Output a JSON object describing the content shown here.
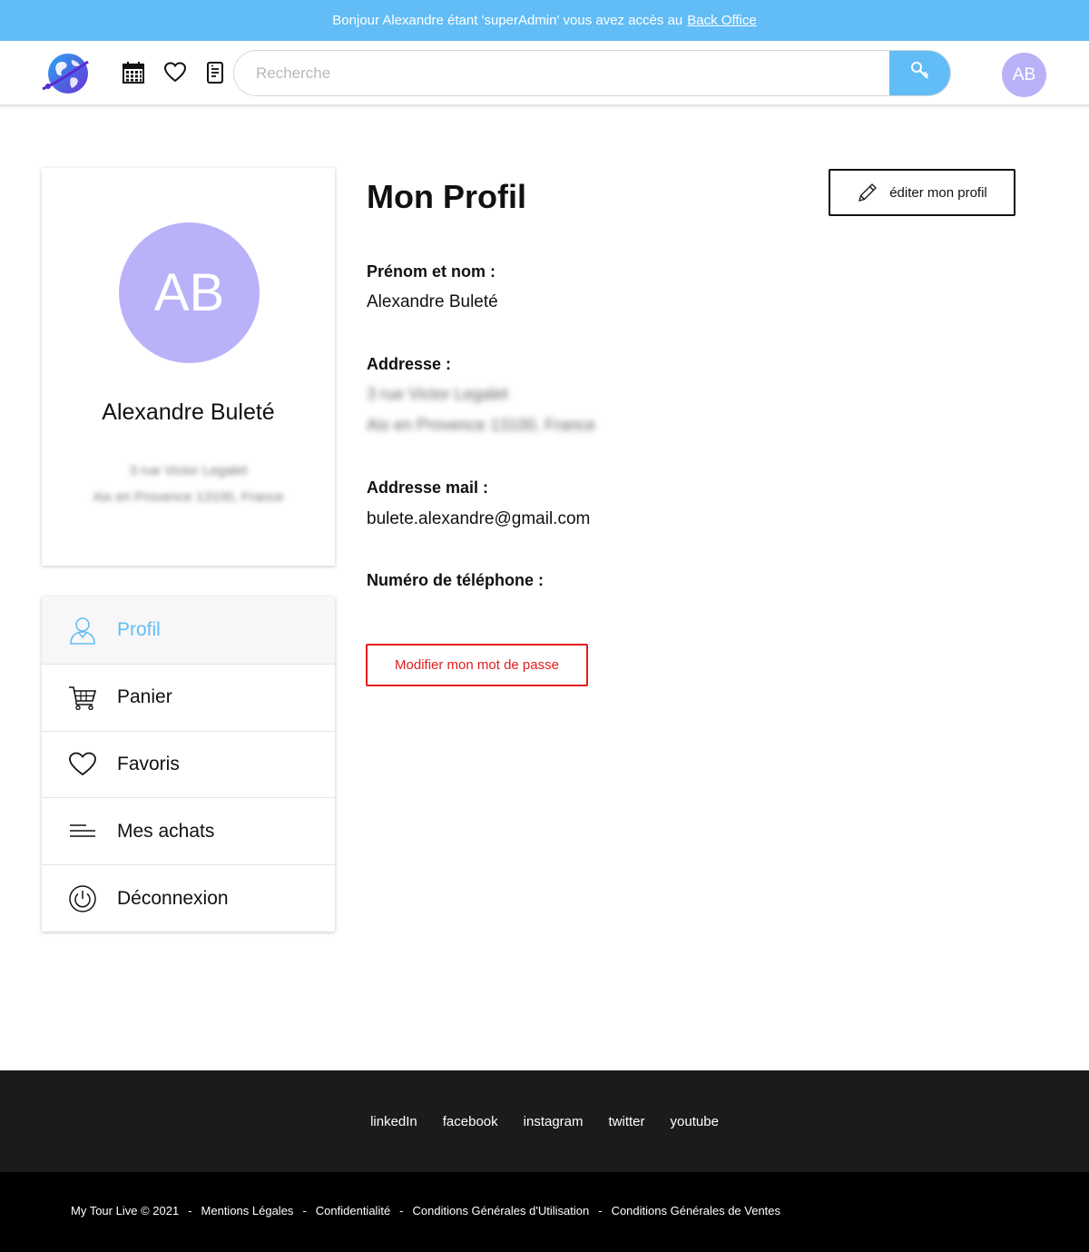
{
  "banner": {
    "text": "Bonjour Alexandre étant 'superAdmin' vous avez accès au",
    "link": "Back Office"
  },
  "header": {
    "search_placeholder": "Recherche",
    "avatar_initials": "AB",
    "icons": [
      "globe-logo-icon",
      "calendar-icon",
      "heart-icon",
      "document-icon",
      "key-icon"
    ]
  },
  "profile_card": {
    "initials": "AB",
    "name": "Alexandre Buleté",
    "address_line1": "3 rue Victor Legalet",
    "address_line2": "Aix en Provence 13100, France"
  },
  "menu": {
    "items": [
      {
        "label": "Profil",
        "icon": "user-icon"
      },
      {
        "label": "Panier",
        "icon": "cart-icon"
      },
      {
        "label": "Favoris",
        "icon": "heart-icon"
      },
      {
        "label": "Mes achats",
        "icon": "list-icon"
      },
      {
        "label": "Déconnexion",
        "icon": "power-icon"
      }
    ]
  },
  "main": {
    "title": "Mon Profil",
    "edit_button": "éditer mon profil",
    "name_label": "Prénom et nom :",
    "name_value": "Alexandre Buleté",
    "address_label": "Addresse :",
    "address_line1": "3 rue Victor Legalet",
    "address_line2": "Aix en Provence 13100, France",
    "email_label": "Addresse mail :",
    "email_value": "bulete.alexandre@gmail.com",
    "phone_label": "Numéro de téléphone :",
    "password_button": "Modifier mon mot de passe"
  },
  "footer": {
    "social": [
      "linkedIn",
      "facebook",
      "instagram",
      "twitter",
      "youtube"
    ],
    "copyright": "My Tour Live © 2021",
    "links": [
      "Mentions Légales",
      "Confidentialité",
      "Conditions Générales d'Utilisation",
      "Conditions Générales de Ventes"
    ],
    "separator": "-"
  },
  "colors": {
    "accent": "#62bdf6",
    "avatar": "#b9b2f9",
    "danger": "#e31d1d",
    "footer_top": "#1b1b1b",
    "footer_bottom": "#000000"
  }
}
